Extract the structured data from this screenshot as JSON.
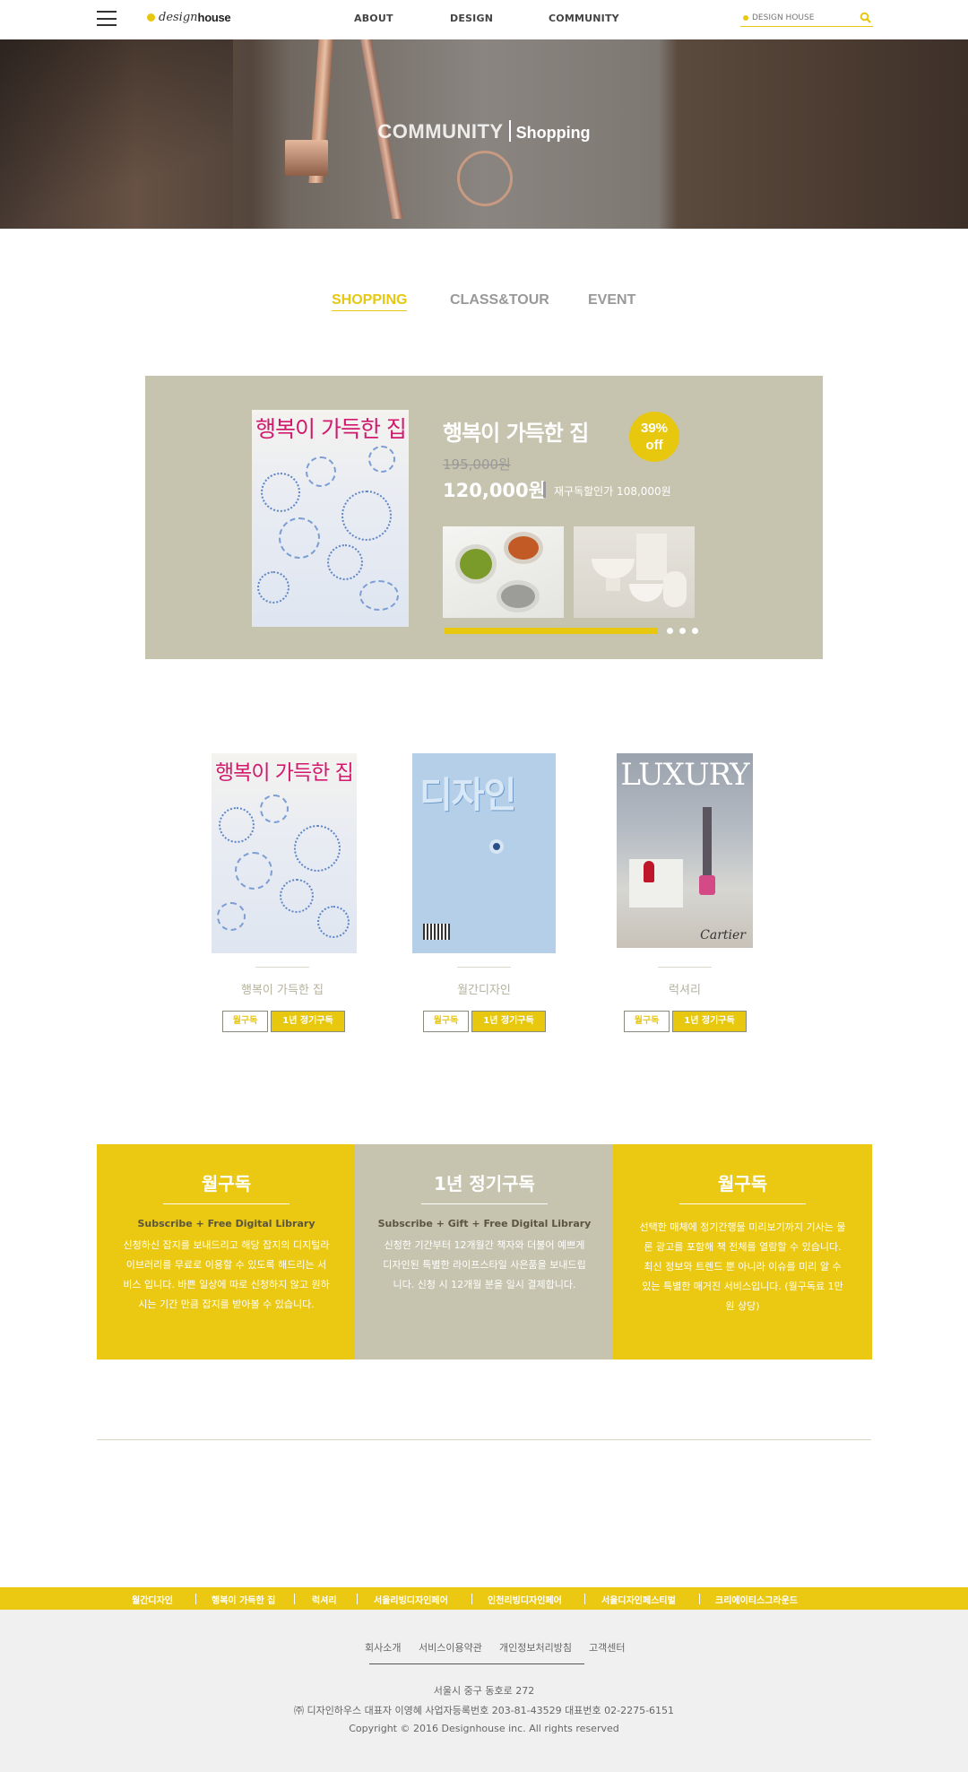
{
  "header": {
    "logo_part1": "design",
    "logo_part2": "house",
    "nav": [
      "ABOUT",
      "DESIGN",
      "COMMUNITY"
    ],
    "search_placeholder": "DESIGN HOUSE"
  },
  "hero": {
    "title": "COMMUNITY",
    "subtitle": "Shopping"
  },
  "tabs": [
    {
      "label": "SHOPPING",
      "active": true
    },
    {
      "label": "CLASS&TOUR",
      "active": false
    },
    {
      "label": "EVENT",
      "active": false
    }
  ],
  "featured": {
    "cover_title": "행복이 가득한 집",
    "title": "행복이 가득한 집",
    "discount_line1": "39%",
    "discount_line2": "off",
    "original_price": "195,000원",
    "price": "120,000원",
    "renewal_price": "재구독할인가 108,000원",
    "slide_count": 3
  },
  "products": [
    {
      "name": "행복이 가득한 집",
      "cover_title": "행복이 가득한 집",
      "monthly_label": "월구독",
      "yearly_label": "1년 정기구독"
    },
    {
      "name": "월간디자인",
      "cover_title": "디자인",
      "monthly_label": "월구독",
      "yearly_label": "1년 정기구독"
    },
    {
      "name": "럭셔리",
      "cover_title": "LUXURY",
      "cover_sub": "Cartier",
      "monthly_label": "월구독",
      "yearly_label": "1년 정기구독"
    }
  ],
  "subscription_boxes": [
    {
      "title": "월구독",
      "subtitle": "Subscribe + Free Digital Library",
      "description": "신청하신 잡지를 보내드리고 해당 잡지의 디지털라이브러리를 무료로 이용할 수 있도록 해드리는 서비스 입니다. 바쁜 일상에 따로 신청하지 않고 원하시는 기간 만큼 잡지를 받아볼 수 있습니다.",
      "color": "#ebc812"
    },
    {
      "title": "1년 정기구독",
      "subtitle": "Subscribe + Gift + Free Digital Library",
      "description": "신청한 기간부터 12개월간 책자와 더불어 예쁘게 디자인된 특별한 라이프스타일 사은품을 보내드립니다. 신청 시 12개월 분을 일시 결제합니다.",
      "color": "#c6c3ae"
    },
    {
      "title": "월구독",
      "subtitle": "",
      "description": "선택한 매체에 정기간행물 미리보기까지 기사는 물론 광고를 포함해 책 전체를 열람할 수 있습니다. 최신 정보와 트렌드 뿐 아니라 이슈를 미리 알 수 있는 특별한 매거진 서비스입니다. (월구독료 1만 원 상당)",
      "color": "#ebc812"
    }
  ],
  "footer": {
    "family_links": [
      "월간디자인",
      "행복이 가득한 집",
      "럭셔리",
      "서울리빙디자인페어",
      "인천리빙디자인페어",
      "서울디자인페스티벌",
      "크리에이티스그라운드"
    ],
    "nav": [
      "회사소개",
      "서비스이용약관",
      "개인정보처리방침",
      "고객센터"
    ],
    "address": "서울시 중구 동호로 272",
    "company_info": "㈜ 디자인하우스 대표자 이영혜 사업자등록번호 203-81-43529 대표번호 02-2275-6151",
    "copyright": "Copyright © 2016 Designhouse inc. All rights reserved"
  },
  "colors": {
    "accent": "#e8c70f",
    "beige": "#c6c3ae"
  }
}
